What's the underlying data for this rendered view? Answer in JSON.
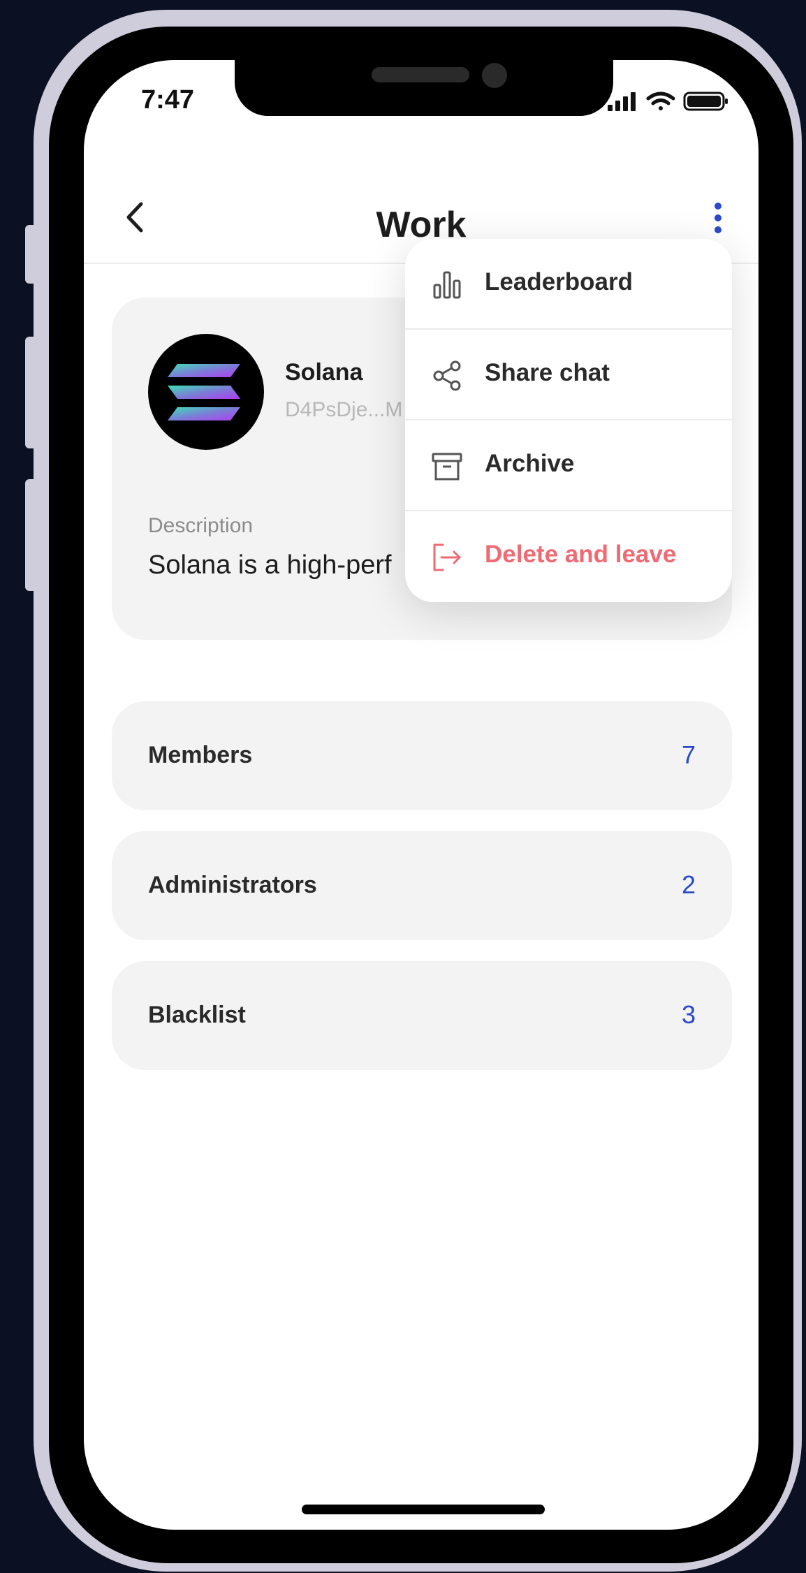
{
  "status_bar": {
    "time": "7:47"
  },
  "header": {
    "title": "Work"
  },
  "chat": {
    "name": "Solana",
    "address": "D4PsDje...M",
    "description_label": "Description",
    "description": "Solana is a high-perf"
  },
  "stats": [
    {
      "label": "Members",
      "count": "7"
    },
    {
      "label": "Administrators",
      "count": "2"
    },
    {
      "label": "Blacklist",
      "count": "3"
    }
  ],
  "menu": {
    "items": [
      {
        "label": "Leaderboard",
        "icon": "bar-chart-icon"
      },
      {
        "label": "Share chat",
        "icon": "share-icon"
      },
      {
        "label": "Archive",
        "icon": "archive-icon"
      },
      {
        "label": "Delete and leave",
        "icon": "logout-icon"
      }
    ]
  },
  "colors": {
    "accent": "#2b4ac9",
    "danger": "#ef6b74",
    "card_bg": "#f3f3f3",
    "backdrop": "#0b1122"
  }
}
